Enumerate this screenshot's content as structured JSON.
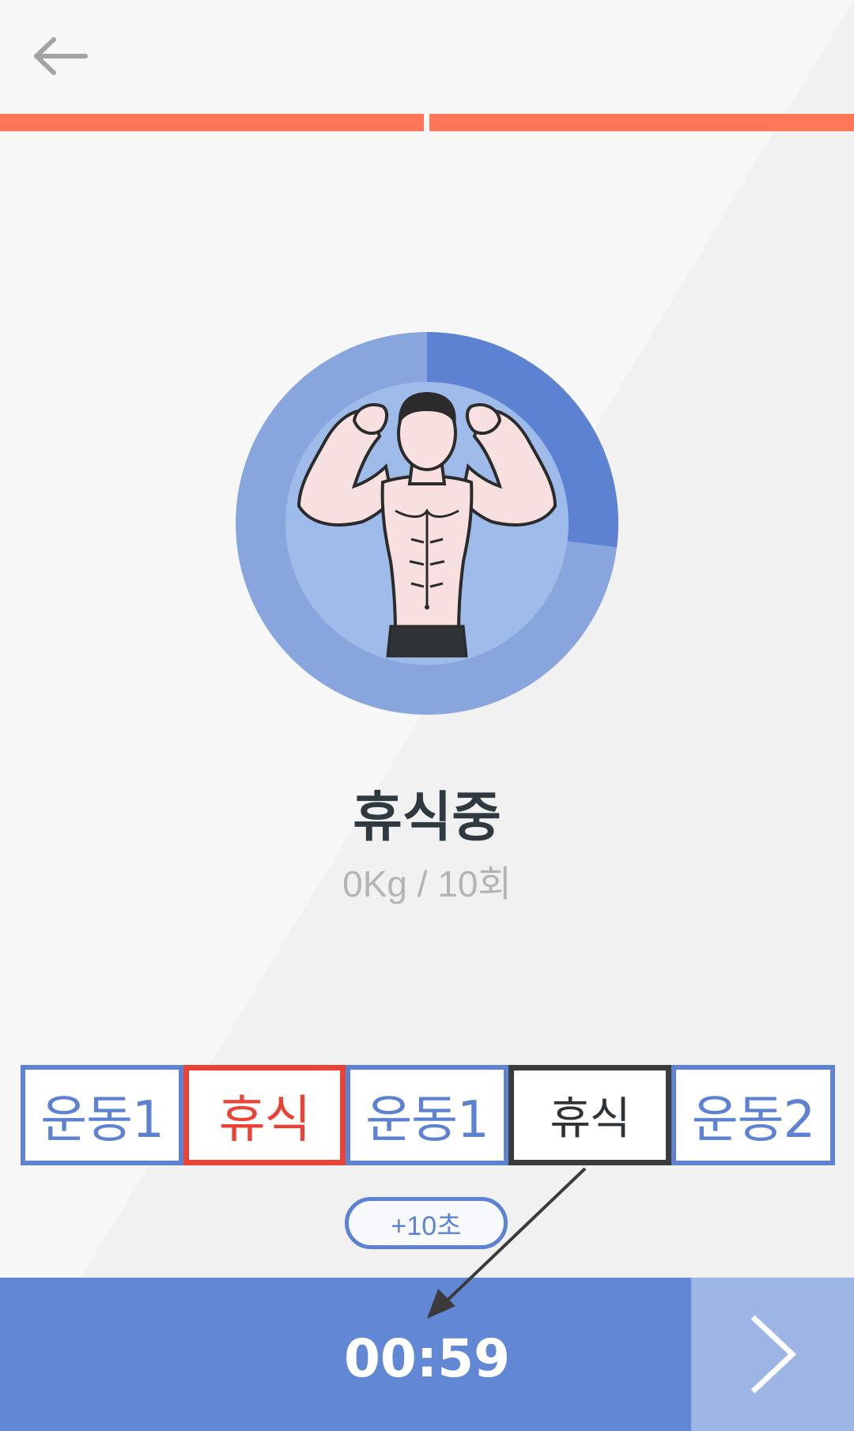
{
  "colors": {
    "background_light": "#f7f7f7",
    "background_dark": "#f0f0f0",
    "progress": "#ff7758",
    "ring_track": "#88a5dd",
    "ring_progress": "#5d82d1",
    "avatar_fill": "#9fbbea",
    "exercise": "#5d82d1",
    "rest_current": "#ea4335",
    "rest_next": "#3b3b3b",
    "bottom_bar": "#6288d5",
    "next_button": "#9db5e4"
  },
  "header": {
    "back_icon": "arrow-left-icon"
  },
  "progress": {
    "segments_total": 2,
    "segments_done": 2
  },
  "timer_ring": {
    "fraction_elapsed": 0.27,
    "avatar_icon": "muscle-man-icon"
  },
  "status": {
    "title": "휴식중",
    "detail": "0Kg / 10회"
  },
  "phases": [
    {
      "label": "운동1",
      "kind": "exercise"
    },
    {
      "label": "휴식",
      "kind": "rest-current"
    },
    {
      "label": "운동1",
      "kind": "exercise"
    },
    {
      "label": "휴식",
      "kind": "rest-next"
    },
    {
      "label": "운동2",
      "kind": "exercise"
    }
  ],
  "add_time": {
    "label": "+10초"
  },
  "bottom": {
    "timer": "00:59",
    "next_icon": "chevron-right-icon"
  }
}
